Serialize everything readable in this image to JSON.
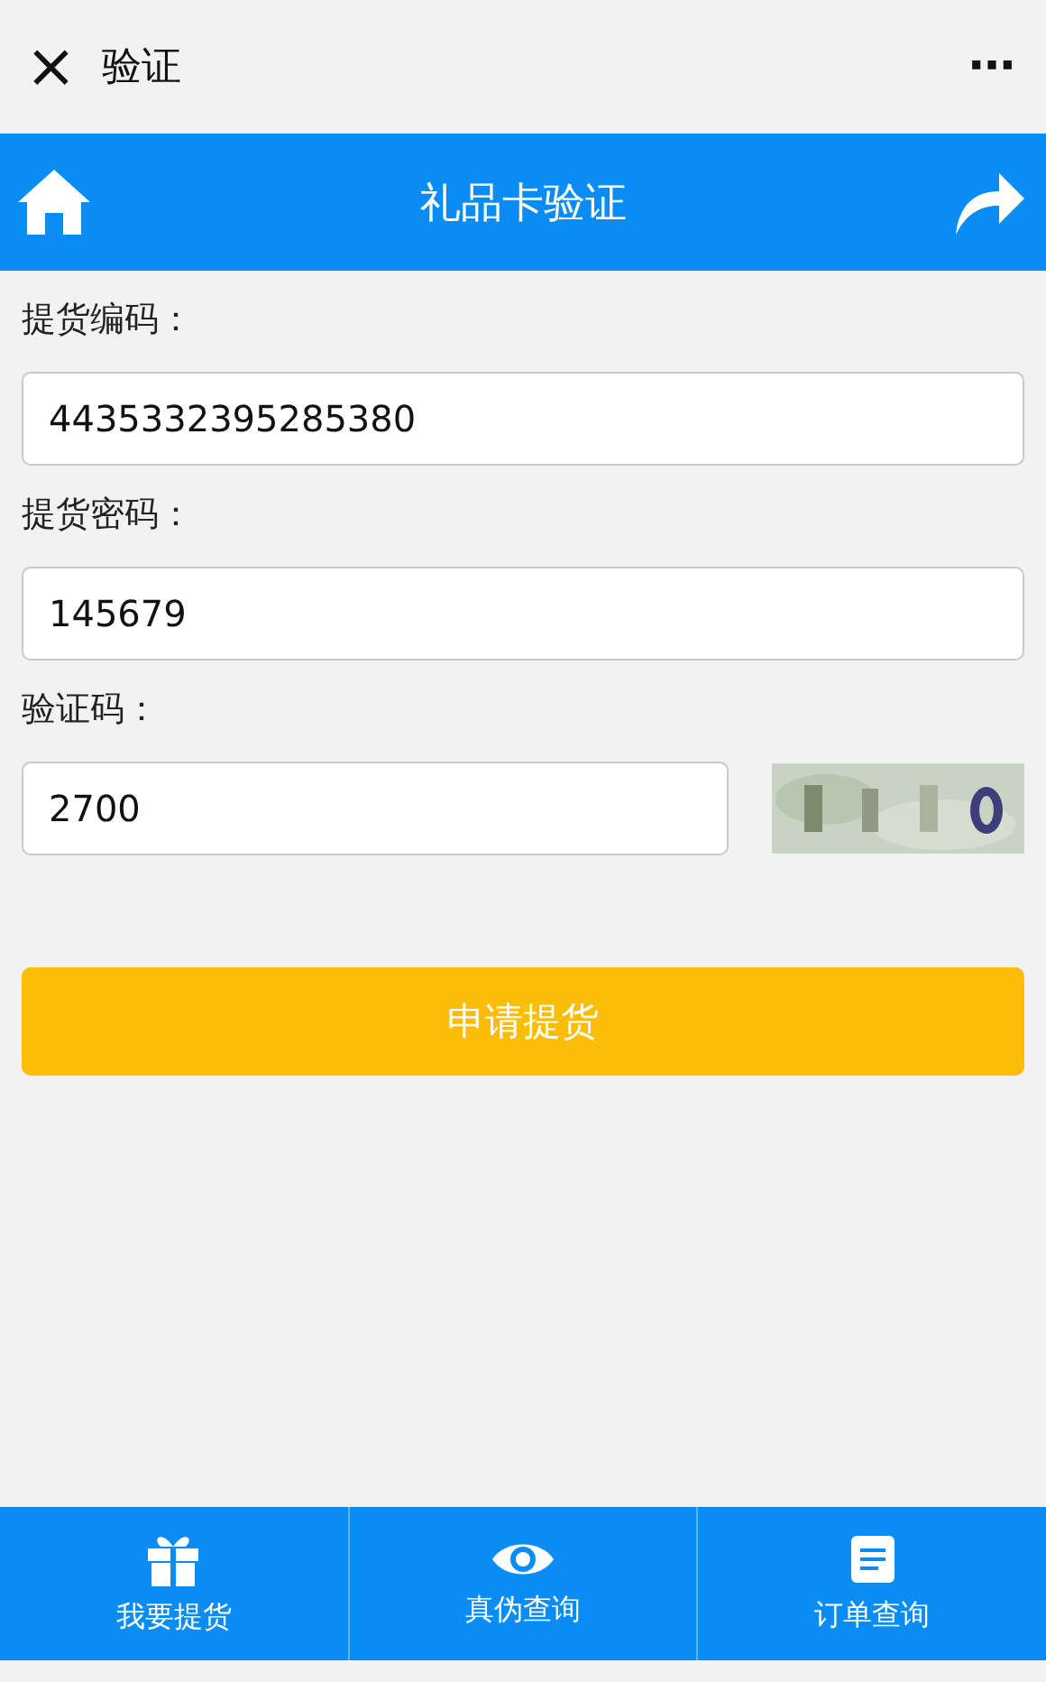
{
  "top_bar": {
    "close": "×",
    "title": "验证",
    "more": "⋯"
  },
  "header": {
    "title": "礼品卡验证"
  },
  "fields": [
    {
      "kind": "text",
      "label": "提货编码：",
      "value": "4435332395285380"
    },
    {
      "kind": "text",
      "label": "提货密码：",
      "value": "145679"
    },
    {
      "kind": "captcha",
      "label": "验证码：",
      "value": "2700"
    }
  ],
  "submit": "申请提货",
  "tabs": [
    {
      "label": "我要提货",
      "kind": "gift"
    },
    {
      "label": "真伪查询",
      "kind": "eye"
    },
    {
      "label": "订单查询",
      "kind": "list"
    }
  ]
}
